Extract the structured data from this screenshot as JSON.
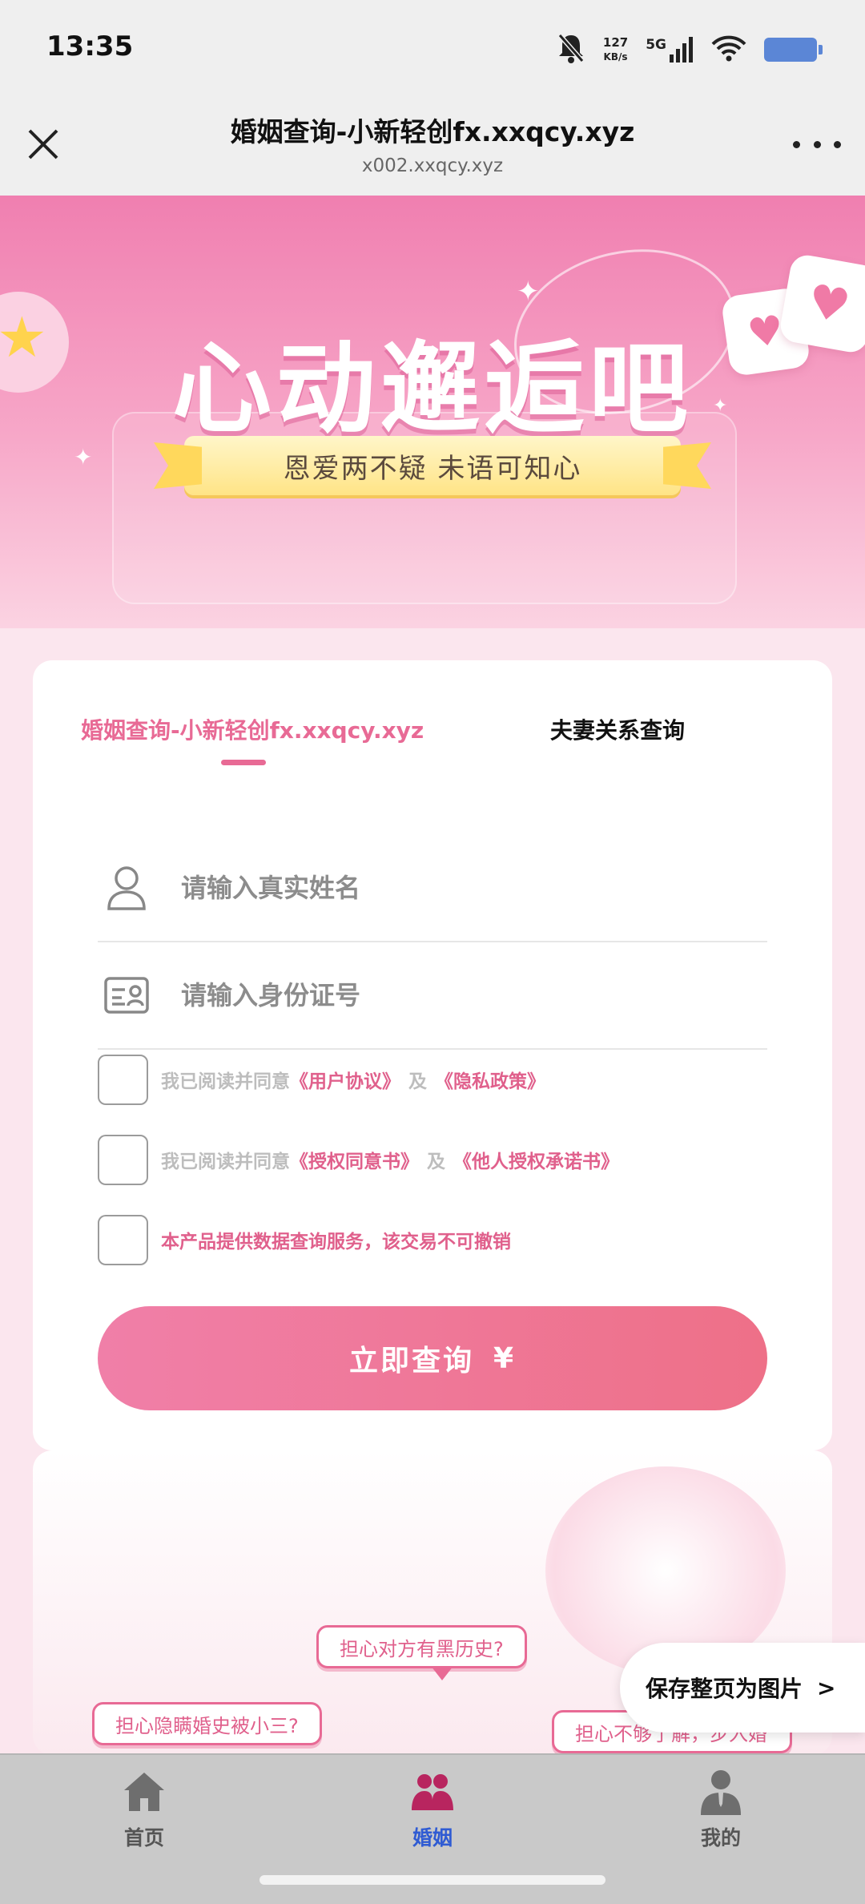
{
  "status_bar": {
    "time": "13:35",
    "speed_value": "127",
    "speed_unit": "KB/s",
    "network": "5G",
    "icons": [
      "bell-off-icon",
      "signal-icon",
      "wifi-icon",
      "battery-icon"
    ]
  },
  "title_bar": {
    "title": "婚姻查询-小新轻创fx.xxqcy.xyz",
    "url": "x002.xxqcy.xyz"
  },
  "banner": {
    "title": "心动邂逅吧",
    "slogan": "恩爱两不疑   未语可知心"
  },
  "tabs": [
    {
      "label": "婚姻查询-小新轻创fx.xxqcy.xyz",
      "active": true
    },
    {
      "label": "夫妻关系查询",
      "active": false
    }
  ],
  "form": {
    "name_placeholder": "请输入真实姓名",
    "id_placeholder": "请输入身份证号",
    "agreement1": {
      "prefix": "我已阅读并同意",
      "doc1": "《用户协议》",
      "joiner": "及",
      "doc2": "《隐私政策》"
    },
    "agreement2": {
      "prefix": "我已阅读并同意",
      "doc1": "《授权同意书》",
      "joiner": "及",
      "doc2": "《他人授权承诺书》"
    },
    "agreement3": "本产品提供数据查询服务，该交易不可撤销",
    "submit_label": "立即查询",
    "currency": "¥"
  },
  "worries": [
    "担心对方有黑历史?",
    "担心隐瞒婚史被小三?",
    "担心不够了解，步入婚"
  ],
  "save_button": {
    "label": "保存整页为图片",
    "chevron": ">"
  },
  "bottom_nav": [
    {
      "label": "首页",
      "icon": "home-icon",
      "active": false
    },
    {
      "label": "婚姻",
      "icon": "couple-icon",
      "active": true
    },
    {
      "label": "我的",
      "icon": "person-icon",
      "active": false
    }
  ],
  "colors": {
    "accent": "#e86a95",
    "nav_active": "#2f5bd3",
    "banner_pink": "#f07fb0"
  }
}
